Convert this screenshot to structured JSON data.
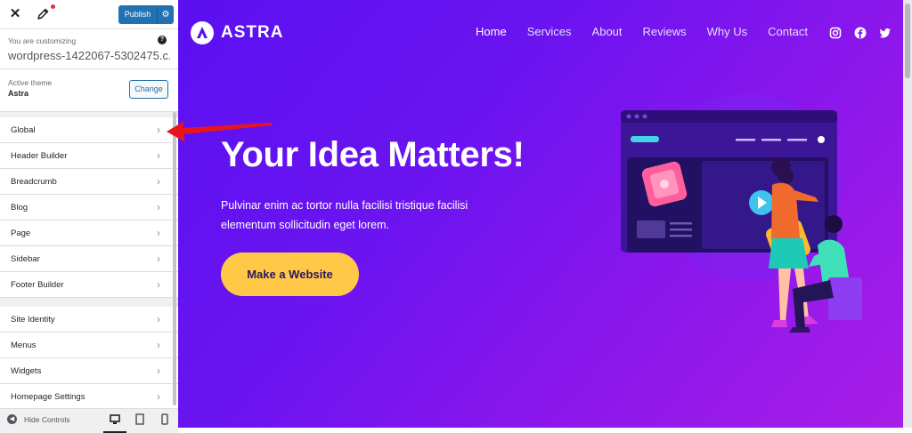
{
  "customizer": {
    "publish_label": "Publish",
    "customizing_label": "You are customizing",
    "site_name": "wordpress-1422067-5302475.c...",
    "active_theme_label": "Active theme",
    "theme_name": "Astra",
    "change_label": "Change",
    "menu_primary": [
      {
        "label": "Global"
      },
      {
        "label": "Header Builder"
      },
      {
        "label": "Breadcrumb"
      },
      {
        "label": "Blog"
      },
      {
        "label": "Page"
      },
      {
        "label": "Sidebar"
      },
      {
        "label": "Footer Builder"
      }
    ],
    "menu_secondary": [
      {
        "label": "Site Identity"
      },
      {
        "label": "Menus"
      },
      {
        "label": "Widgets"
      },
      {
        "label": "Homepage Settings"
      }
    ],
    "hide_controls_label": "Hide Controls",
    "help_glyph": "?",
    "chevron_glyph": "›",
    "close_glyph": "✕",
    "gear_glyph": "⚙",
    "hide_glyph": "◀"
  },
  "site": {
    "logo_text": "ASTRA",
    "nav": [
      {
        "label": "Home"
      },
      {
        "label": "Services"
      },
      {
        "label": "About"
      },
      {
        "label": "Reviews"
      },
      {
        "label": "Why Us"
      },
      {
        "label": "Contact"
      }
    ],
    "hero_title": "Your Idea Matters!",
    "hero_text": "Pulvinar enim ac tortor nulla facilisi tristique facilisi elementum sollicitudin eget lorem.",
    "cta_label": "Make a Website"
  },
  "colors": {
    "publish_blue": "#2271b1",
    "hero_gradient_start": "#5a10f2",
    "hero_gradient_end": "#a81ee6",
    "cta_yellow": "#ffc947",
    "annotation_red": "#e8161c"
  },
  "icons": [
    "close-icon",
    "pencil-icon",
    "help-icon",
    "gear-icon",
    "chevron-right-icon",
    "hide-controls-icon",
    "desktop-icon",
    "tablet-icon",
    "mobile-icon",
    "instagram-icon",
    "facebook-icon",
    "twitter-icon",
    "astra-logo-icon"
  ]
}
